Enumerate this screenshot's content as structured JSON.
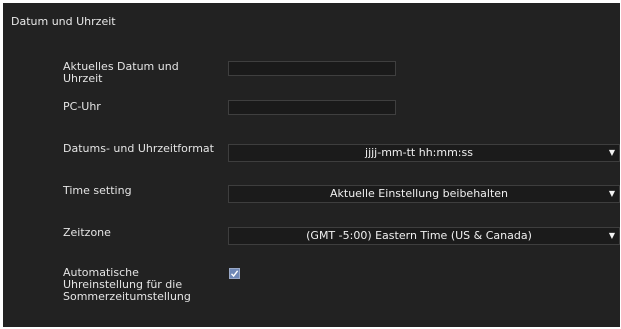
{
  "section": {
    "title": "Datum und Uhrzeit"
  },
  "fields": {
    "current_datetime": {
      "label_line1": "Aktuelles Datum und",
      "label_line2": "Uhrzeit",
      "value": ""
    },
    "pc_clock": {
      "label": "PC-Uhr",
      "value": ""
    },
    "datetime_format": {
      "label": "Datums- und Uhrzeitformat",
      "selected": "jjjj-mm-tt hh:mm:ss"
    },
    "time_setting": {
      "label": "Time setting",
      "selected": "Aktuelle Einstellung beibehalten"
    },
    "timezone": {
      "label": "Zeitzone",
      "selected": "(GMT -5:00) Eastern Time (US & Canada)"
    },
    "dst": {
      "label_line1": "Automatische",
      "label_line2": "Uhreinstellung für die",
      "label_line3": "Sommerzeitumstellung",
      "checked": true
    }
  },
  "icons": {
    "dropdown": "chevron-down-icon",
    "check": "checkmark-icon"
  },
  "colors": {
    "panel_bg": "#222222",
    "input_bg": "#1a1a1a",
    "checkbox_fill": "#6f88b6",
    "text": "#e6e6e6"
  }
}
